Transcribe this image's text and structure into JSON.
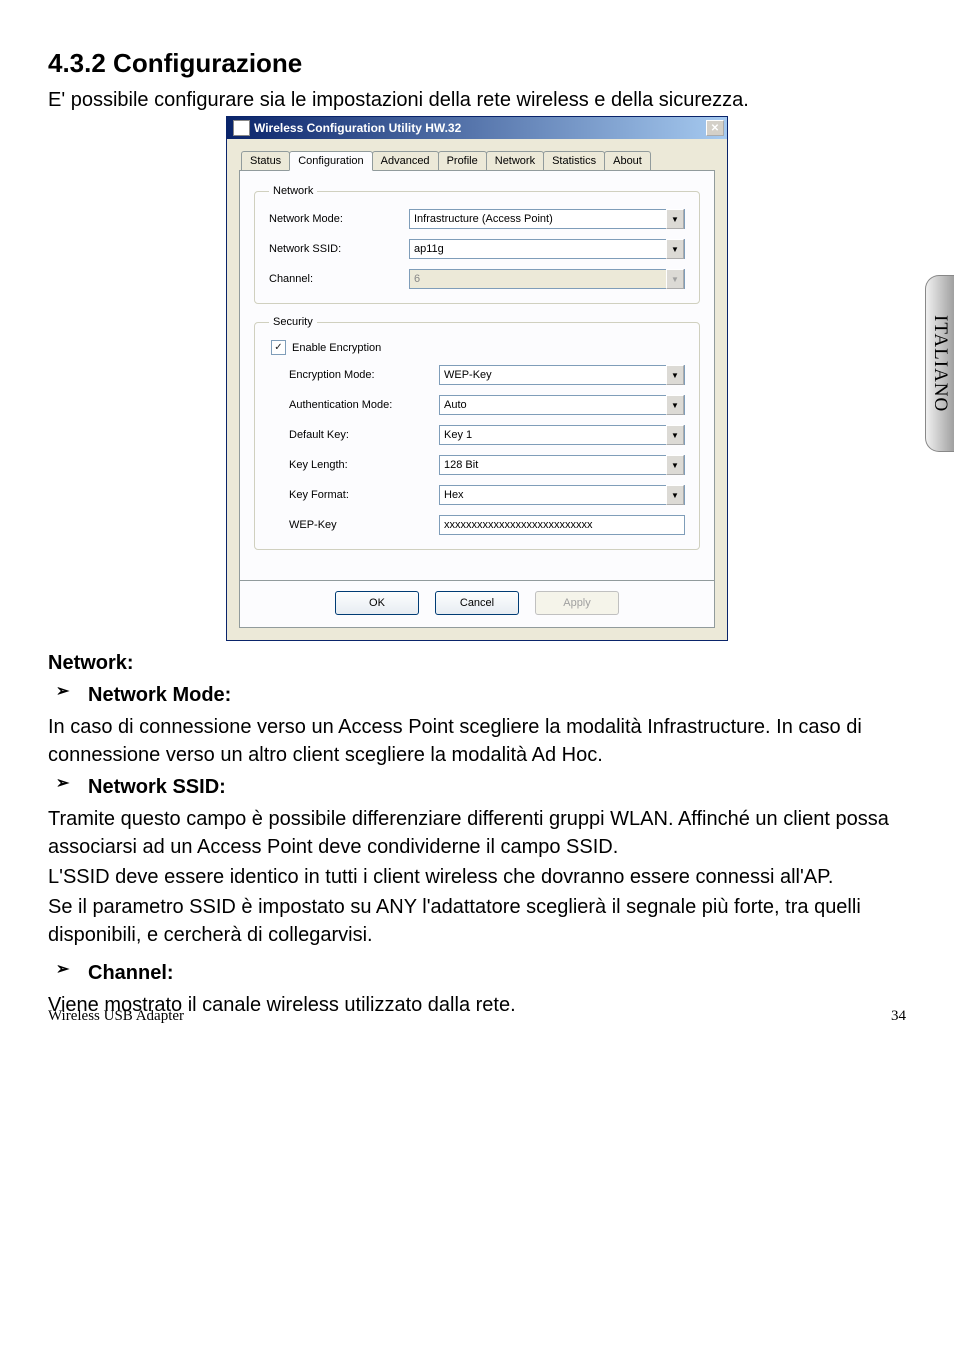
{
  "heading": "4.3.2 Configurazione",
  "intro": "E' possibile configurare sia le impostazioni della rete wireless e della sicurezza.",
  "sidetab": "ITALIANO",
  "dialog": {
    "title": "Wireless Configuration Utility HW.32",
    "tabs": [
      "Status",
      "Configuration",
      "Advanced",
      "Profile",
      "Network",
      "Statistics",
      "About"
    ],
    "active_tab_index": 1,
    "network": {
      "legend": "Network",
      "mode_label": "Network Mode:",
      "mode_value": "Infrastructure (Access Point)",
      "ssid_label": "Network SSID:",
      "ssid_value": "ap11g",
      "channel_label": "Channel:",
      "channel_value": "6"
    },
    "security": {
      "legend": "Security",
      "enable_label": "Enable Encryption",
      "enable_checked": true,
      "enc_mode_label": "Encryption Mode:",
      "enc_mode_value": "WEP-Key",
      "auth_mode_label": "Authentication Mode:",
      "auth_mode_value": "Auto",
      "default_key_label": "Default Key:",
      "default_key_value": "Key 1",
      "key_length_label": "Key Length:",
      "key_length_value": "128 Bit",
      "key_format_label": "Key Format:",
      "key_format_value": "Hex",
      "wep_key_label": "WEP-Key",
      "wep_key_value": "xxxxxxxxxxxxxxxxxxxxxxxxxxx"
    },
    "buttons": {
      "ok": "OK",
      "cancel": "Cancel",
      "apply": "Apply"
    }
  },
  "doc": {
    "network_heading": "Network:",
    "network_mode_heading": "Network Mode:",
    "network_mode_text": "In caso di connessione verso un Access Point scegliere la modalità Infrastructure. In caso di connessione verso un altro client scegliere la modalità Ad Hoc.",
    "network_ssid_heading": "Network SSID:",
    "ssid_p1": "Tramite questo campo è possibile differenziare differenti gruppi WLAN. Affinché un client possa associarsi ad un Access Point deve condividerne il campo SSID.",
    "ssid_p2": "L'SSID deve essere identico in tutti i client wireless che dovranno essere connessi all'AP.",
    "ssid_p3": "Se il parametro SSID è impostato su ANY l'adattatore sceglierà il segnale più forte, tra quelli disponibili, e cercherà di collegarvisi.",
    "channel_heading": "Channel:",
    "channel_text": "Viene mostrato il canale wireless utilizzato dalla rete."
  },
  "footer": {
    "left": "Wireless USB Adapter",
    "right": "34"
  }
}
